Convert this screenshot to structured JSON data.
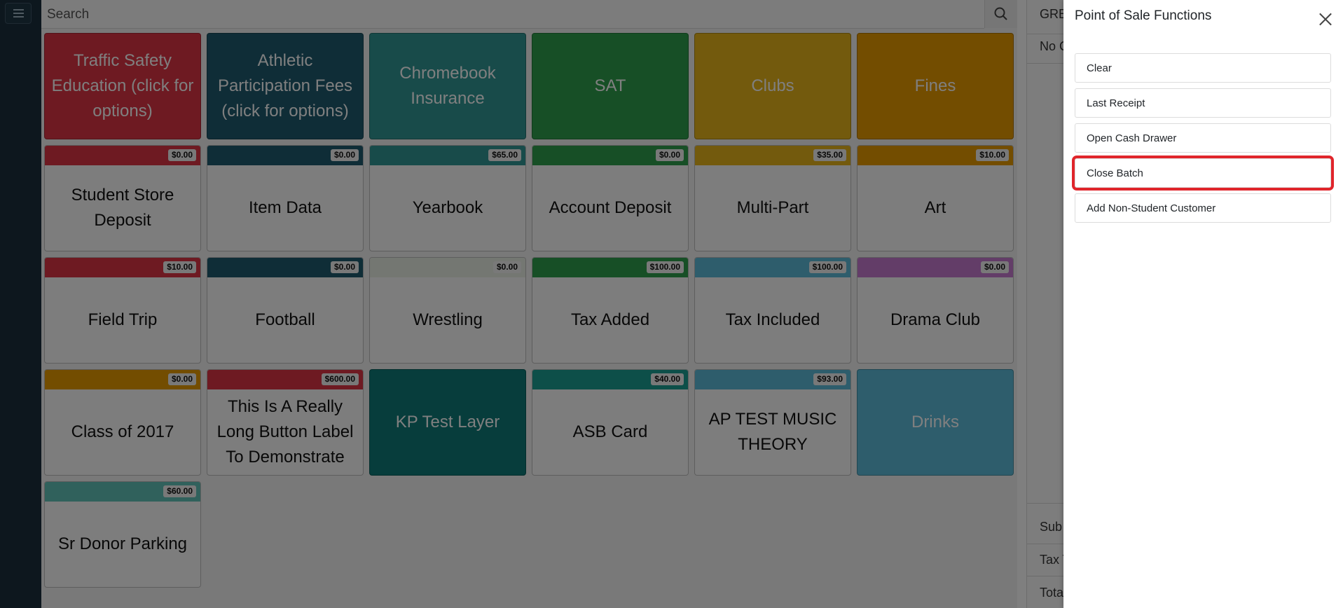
{
  "search": {
    "placeholder": "Search"
  },
  "right_panel": {
    "line1": "GRE",
    "line2": "No C",
    "subtotal": "Sub",
    "tax": "Tax T",
    "total": "Tota"
  },
  "tiles": [
    {
      "label": "Traffic Safety Education (click for options)",
      "color": "#dd3545",
      "style": "solid"
    },
    {
      "label": "Athletic Participation Fees (click for options)",
      "color": "#1f5b6e",
      "style": "solid"
    },
    {
      "label": "Chromebook Insurance",
      "color": "#319795",
      "style": "solid"
    },
    {
      "label": "SAT",
      "color": "#2e9e4c",
      "style": "solid"
    },
    {
      "label": "Clubs",
      "color": "#e6b41a",
      "style": "solid"
    },
    {
      "label": "Fines",
      "color": "#e69a00",
      "style": "solid"
    },
    {
      "label": "Student Store Deposit",
      "price": "$0.00",
      "color": "#dd3545",
      "style": "band"
    },
    {
      "label": "Item Data",
      "price": "$0.00",
      "color": "#1f5b6e",
      "style": "band"
    },
    {
      "label": "Yearbook",
      "price": "$65.00",
      "color": "#319795",
      "style": "band"
    },
    {
      "label": "Account Deposit",
      "price": "$0.00",
      "color": "#2e9e4c",
      "style": "band"
    },
    {
      "label": "Multi-Part",
      "price": "$35.00",
      "color": "#e6b41a",
      "style": "band"
    },
    {
      "label": "Art",
      "price": "$10.00",
      "color": "#e69a00",
      "style": "band"
    },
    {
      "label": "Field Trip",
      "price": "$10.00",
      "color": "#dd3545",
      "style": "band"
    },
    {
      "label": "Football",
      "price": "$0.00",
      "color": "#1f5b6e",
      "style": "band"
    },
    {
      "label": "Wrestling",
      "price": "$0.00",
      "color": "#e8eee5",
      "style": "band"
    },
    {
      "label": "Tax Added",
      "price": "$100.00",
      "color": "#2e9e4c",
      "style": "band"
    },
    {
      "label": "Tax Included",
      "price": "$100.00",
      "color": "#5dbbd9",
      "style": "band"
    },
    {
      "label": "Drama Club",
      "price": "$0.00",
      "color": "#c77bd1",
      "style": "band"
    },
    {
      "label": "Class of 2017",
      "price": "$0.00",
      "color": "#e69a00",
      "style": "band"
    },
    {
      "label": "This Is A Really Long Button Label To Demonstrate",
      "price": "$600.00",
      "color": "#dd3545",
      "style": "band"
    },
    {
      "label": "KP Test Layer",
      "color": "#0e7b78",
      "style": "solid"
    },
    {
      "label": "ASB Card",
      "price": "$40.00",
      "color": "#1a9e92",
      "style": "band"
    },
    {
      "label": "AP TEST MUSIC THEORY",
      "price": "$93.00",
      "color": "#5dbbd9",
      "style": "band"
    },
    {
      "label": "Drinks",
      "color": "#5dbbd9",
      "style": "solid"
    },
    {
      "label": "Sr Donor Parking",
      "price": "$60.00",
      "color": "#60c2b9",
      "style": "band"
    }
  ],
  "drawer": {
    "title": "Point of Sale Functions",
    "buttons": [
      "Clear",
      "Last Receipt",
      "Open Cash Drawer",
      "Close Batch",
      "Add Non-Student Customer"
    ],
    "highlighted": "Close Batch"
  }
}
